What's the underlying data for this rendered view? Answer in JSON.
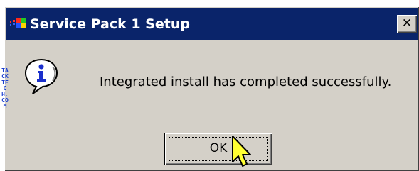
{
  "window": {
    "title": "Service Pack 1 Setup",
    "title_icon": "windows-flag-icon",
    "close_label": "✕"
  },
  "message": {
    "icon": "information-icon",
    "text": "Integrated install has completed successfully."
  },
  "buttons": {
    "ok_label": "OK"
  },
  "watermark": {
    "text": "TACKTECH.COM"
  },
  "colors": {
    "titlebar": "#0a246a",
    "dialog_face": "#d4d0c8",
    "info_blue": "#1a2fcc",
    "watermark": "#1b3fd0"
  }
}
